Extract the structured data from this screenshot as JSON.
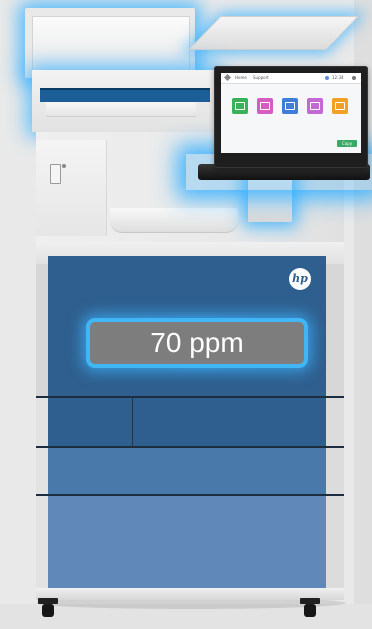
{
  "product": {
    "name": "HP multifunction printer",
    "brand_logo": "hp",
    "speed_label": "70 ppm"
  },
  "control_panel": {
    "tabs": [
      "Home",
      "Support"
    ],
    "status": "12:34",
    "apps": [
      {
        "name": "copy-icon",
        "color": "#3ab25a"
      },
      {
        "name": "scan-icon",
        "color": "#d45cc4"
      },
      {
        "name": "print-icon",
        "color": "#3f7dd8"
      },
      {
        "name": "fax-icon",
        "color": "#c469d4"
      },
      {
        "name": "tools-icon",
        "color": "#f0a126"
      }
    ],
    "action_label": "Copy"
  },
  "colors": {
    "highlight_glow": "#41b6f5",
    "door_primary": "#2f5f8e",
    "drawer_1": "#2f5f8e",
    "drawer_2": "#4978aa",
    "drawer_3": "#6089b9",
    "badge_fill": "#7d7d7d"
  }
}
